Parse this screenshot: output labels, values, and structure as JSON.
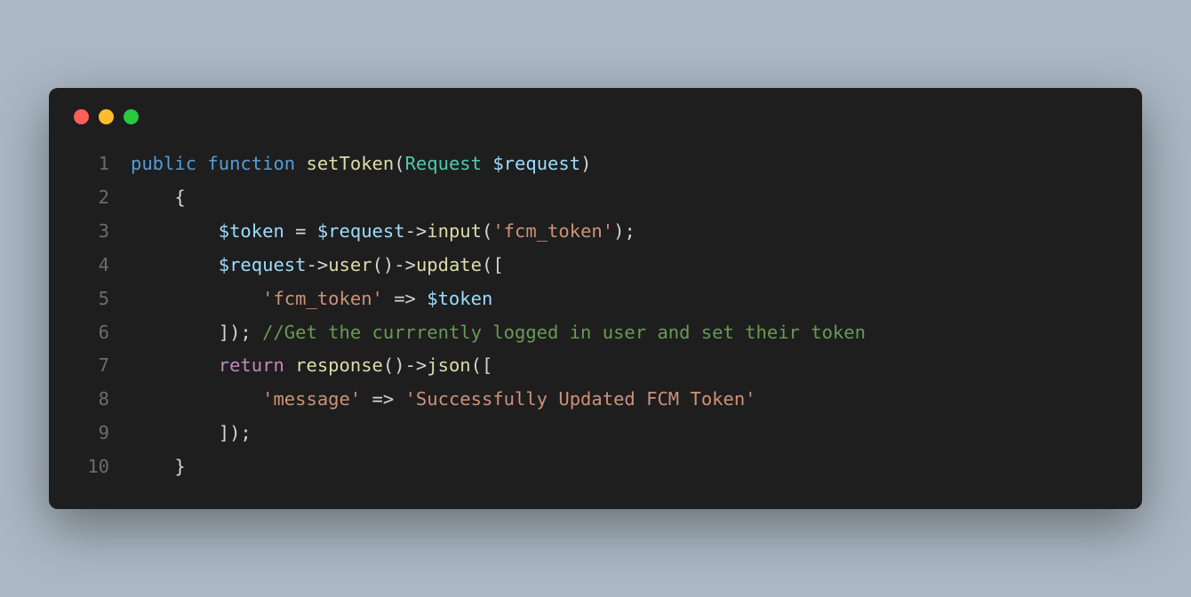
{
  "window": {
    "controls": {
      "close": "close",
      "minimize": "minimize",
      "maximize": "maximize"
    }
  },
  "code": {
    "lines": {
      "n1": "1",
      "n2": "2",
      "n3": "3",
      "n4": "4",
      "n5": "5",
      "n6": "6",
      "n7": "7",
      "n8": "8",
      "n9": "9",
      "n10": "10"
    },
    "l1": {
      "kw_public": "public",
      "kw_function": "function",
      "funcname": "setToken",
      "lparen": "(",
      "type": "Request",
      "var": "$request",
      "rparen": ")"
    },
    "l2": {
      "brace": "{"
    },
    "l3": {
      "var_token": "$token",
      "eq": " = ",
      "var_request": "$request",
      "arrow": "->",
      "method": "input",
      "lparen": "(",
      "str": "'fcm_token'",
      "rparen_semi": ");"
    },
    "l4": {
      "var_request": "$request",
      "arrow1": "->",
      "method_user": "user",
      "parens": "()",
      "arrow2": "->",
      "method_update": "update",
      "lparen_brk": "(["
    },
    "l5": {
      "str_key": "'fcm_token'",
      "darrow": " => ",
      "var_token": "$token"
    },
    "l6": {
      "close": "]); ",
      "comment": "//Get the currrently logged in user and set their token"
    },
    "l7": {
      "kw_return": "return",
      "sp": " ",
      "func_response": "response",
      "parens": "()",
      "arrow": "->",
      "method_json": "json",
      "lparen_brk": "(["
    },
    "l8": {
      "str_key": "'message'",
      "darrow": " => ",
      "str_val": "'Successfully Updated FCM Token'"
    },
    "l9": {
      "close": "]);"
    },
    "l10": {
      "brace": "}"
    }
  }
}
